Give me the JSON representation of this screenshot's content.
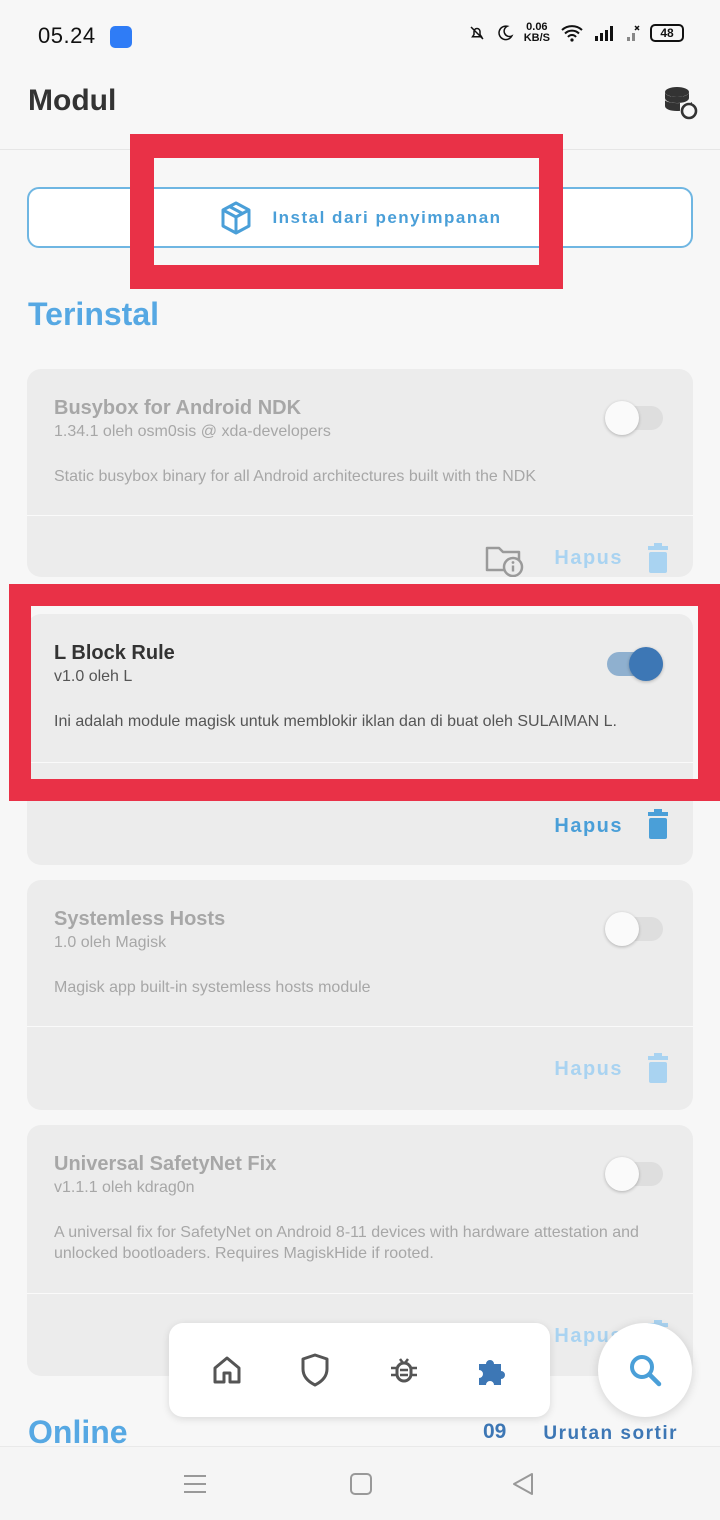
{
  "status": {
    "time": "05.24",
    "net_speed_value": "0.06",
    "net_speed_unit": "KB/S",
    "battery": "48"
  },
  "header": {
    "title": "Modul"
  },
  "install_button": {
    "label": "Instal dari penyimpanan"
  },
  "sections": {
    "installed": "Terinstal",
    "online": "Online"
  },
  "modules": [
    {
      "name": "Busybox for Android NDK",
      "meta": "1.34.1 oleh osm0sis @ xda-developers",
      "description": "Static busybox binary for all Android architectures built with the NDK",
      "enabled": false,
      "remove_label": "Hapus"
    },
    {
      "name": "L Block Rule",
      "meta": "v1.0 oleh L",
      "description": "Ini adalah module magisk untuk memblokir iklan dan di buat oleh SULAIMAN L.",
      "enabled": true,
      "remove_label": "Hapus"
    },
    {
      "name": "Systemless Hosts",
      "meta": "1.0 oleh Magisk",
      "description": "Magisk app built-in systemless hosts module",
      "enabled": false,
      "remove_label": "Hapus"
    },
    {
      "name": "Universal SafetyNet Fix",
      "meta": "v1.1.1 oleh kdrag0n",
      "description": "A universal fix for SafetyNet on Android 8-11 devices with hardware attestation and unlocked bootloaders. Requires MagiskHide if rooted.",
      "enabled": false,
      "remove_label": "Hapus"
    }
  ],
  "sort": {
    "icon_text": "09",
    "label": "Urutan sortir"
  },
  "colors": {
    "accent": "#56a8e3",
    "accent_dark": "#3d77b5",
    "annotation": "#e93147"
  },
  "icons": {
    "app_notification": "app-icon",
    "mute": "bell-off-icon",
    "dnd": "moon-icon",
    "wifi": "wifi-icon",
    "signal": "signal-icon",
    "header_action": "database-sync-icon",
    "install": "package-icon",
    "module_info": "folder-info-icon",
    "remove": "trash-icon",
    "nav_home": "home-icon",
    "nav_superuser": "shield-icon",
    "nav_logs": "bug-icon",
    "nav_modules": "puzzle-icon",
    "search": "search-icon"
  }
}
